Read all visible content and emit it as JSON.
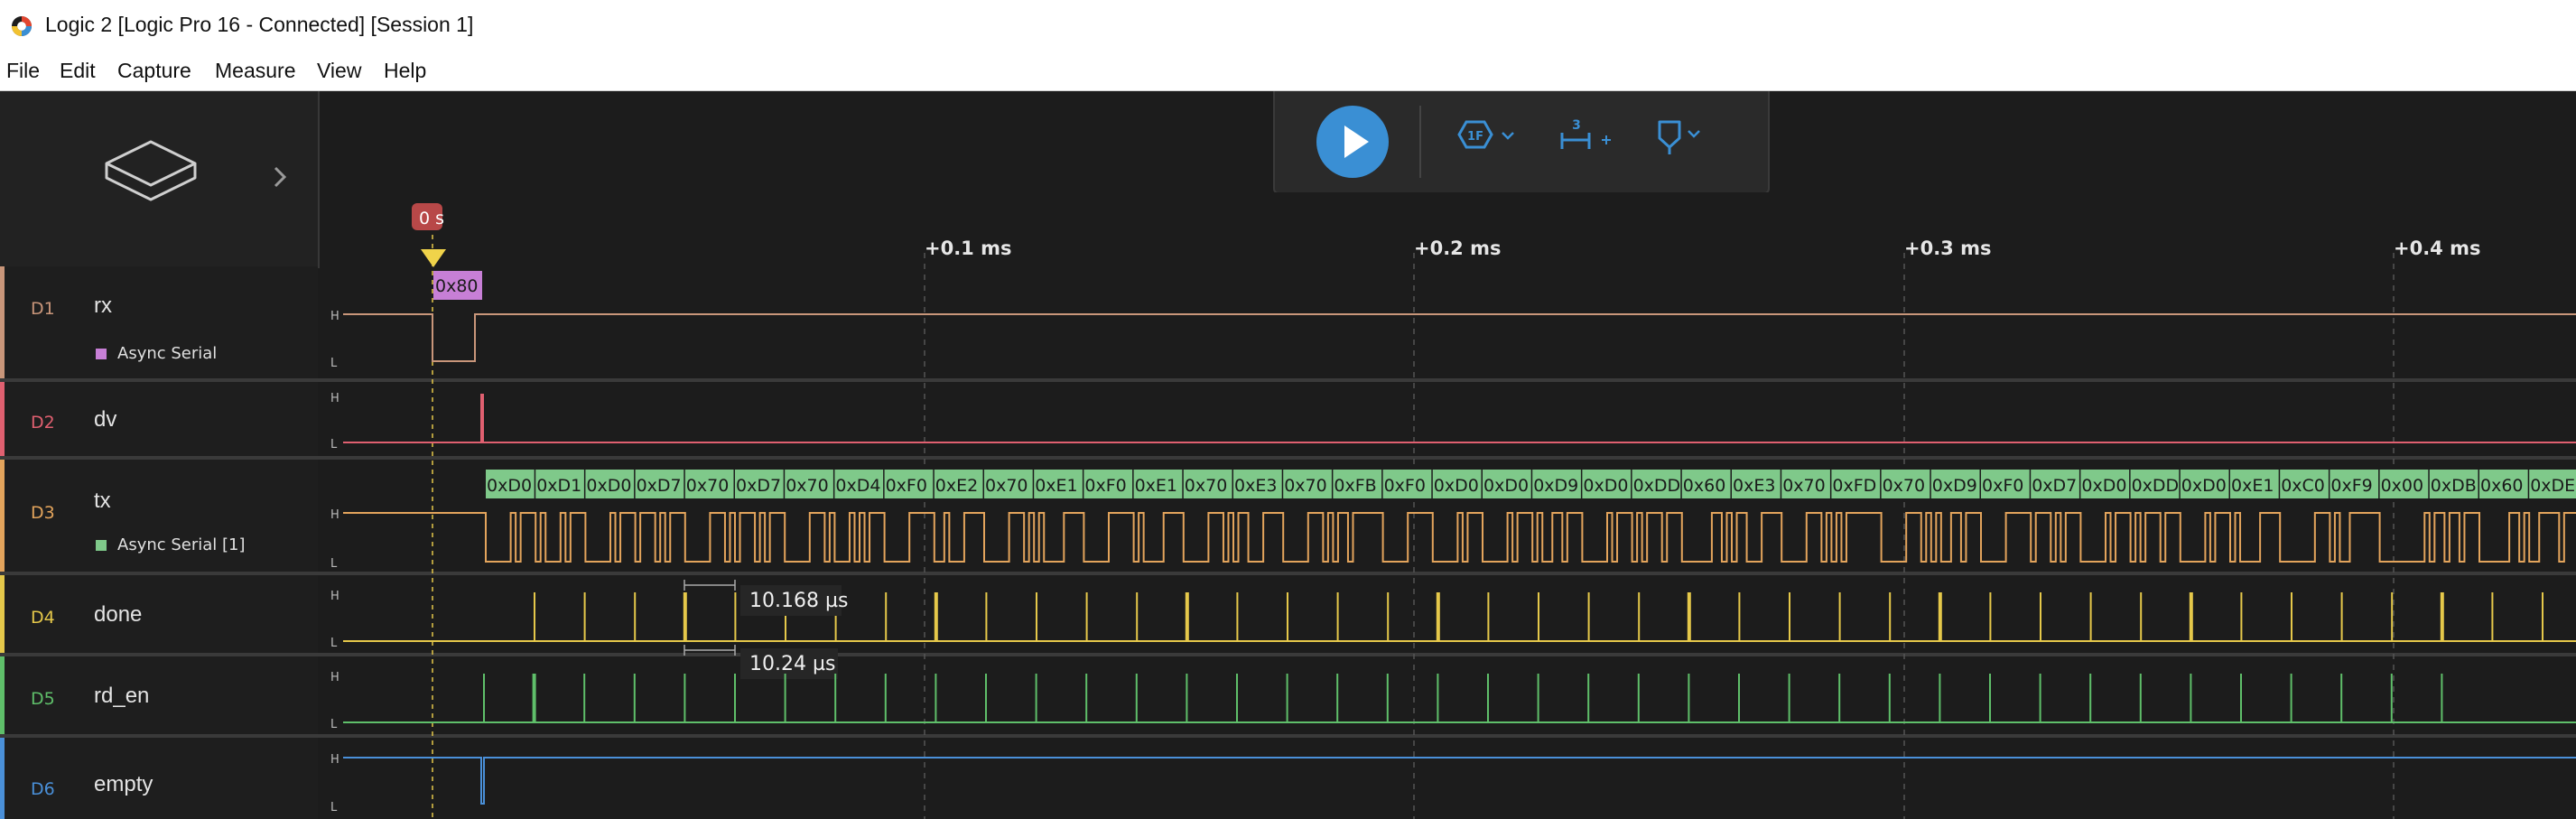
{
  "window": {
    "title": "Logic 2 [Logic Pro 16 - Connected] [Session 1]"
  },
  "menu": {
    "items": [
      "File",
      "Edit",
      "Capture",
      "Measure",
      "View",
      "Help"
    ]
  },
  "icons": {
    "app": "logic-app-icon",
    "device": "device-icon",
    "expand": "chevron-right-icon",
    "play": "play-icon",
    "trigger": "trigger-icon",
    "timing": "timing-marker-icon",
    "marker": "marker-icon"
  },
  "colors": {
    "accent": "#3a8fd4",
    "d1": "#c9967a",
    "d2": "#e06070",
    "d3": "#e3a45c",
    "d4": "#e5c84a",
    "d5": "#5fbf6a",
    "d6": "#4a90d9",
    "async_serial": "#c77fd6",
    "async_serial_1": "#7fc98a"
  },
  "timeline": {
    "marker_label": "0 s",
    "ticks": [
      "+0.1 ms",
      "+0.2 ms",
      "+0.3 ms",
      "+0.4 ms"
    ]
  },
  "channels": [
    {
      "id": "D1",
      "name": "rx",
      "analyzer": "Async Serial",
      "frame": "0x80"
    },
    {
      "id": "D2",
      "name": "dv"
    },
    {
      "id": "D3",
      "name": "tx",
      "analyzer": "Async Serial [1]",
      "frames": [
        "0xD0",
        "0xD1",
        "0xD0",
        "0xD7",
        "0x70",
        "0xD7",
        "0x70",
        "0xD4",
        "0xF0",
        "0xE2",
        "0x70",
        "0xE1",
        "0xF0",
        "0xE1",
        "0x70",
        "0xE3",
        "0x70",
        "0xFB",
        "0xF0",
        "0xD0",
        "0xD0",
        "0xD9",
        "0xD0",
        "0xDD",
        "0x60",
        "0xE3",
        "0x70",
        "0xFD",
        "0x70",
        "0xD9",
        "0xF0",
        "0xD7",
        "0xD0",
        "0xDD",
        "0xD0",
        "0xE1",
        "0xC0",
        "0xF9",
        "0x00",
        "0xDB",
        "0x60",
        "0xDE"
      ]
    },
    {
      "id": "D4",
      "name": "done"
    },
    {
      "id": "D5",
      "name": "rd_en"
    },
    {
      "id": "D6",
      "name": "empty"
    }
  ],
  "measurements": {
    "period": "10.168 µs",
    "width": "10.24 µs"
  },
  "level_labels": {
    "high": "H",
    "low": "L"
  }
}
